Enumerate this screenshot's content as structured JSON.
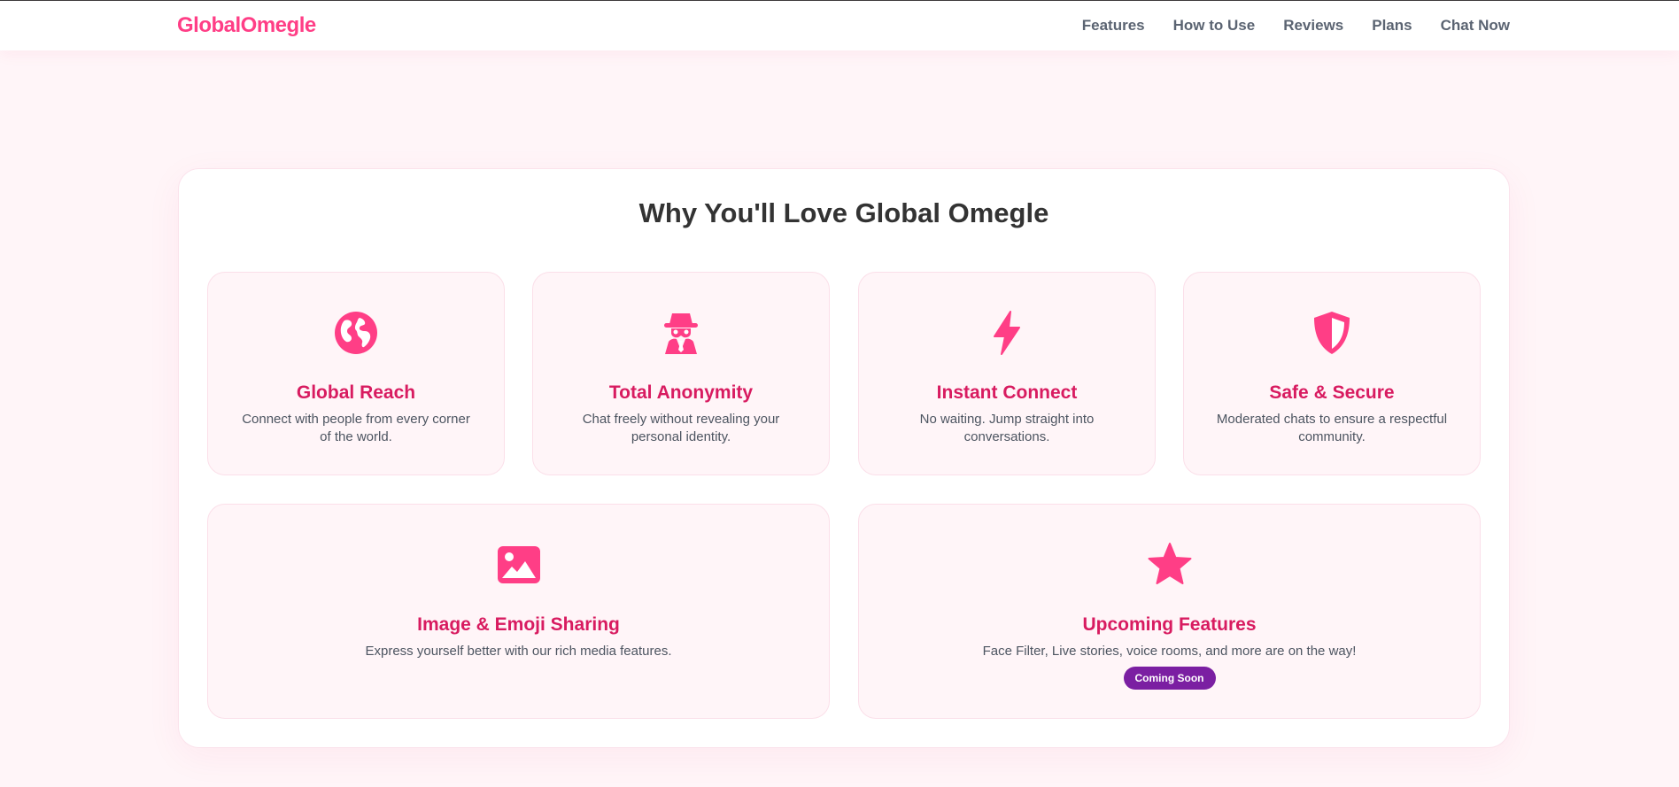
{
  "brand": {
    "name": "GlobalOmegle",
    "color": "#ff3e86"
  },
  "nav": {
    "links": [
      "Features",
      "How to Use",
      "Reviews",
      "Plans",
      "Chat Now"
    ]
  },
  "features_section": {
    "title": "Why You'll Love Global Omegle",
    "cards": [
      {
        "icon": "globe-icon",
        "title": "Global Reach",
        "description": "Connect with people from every corner of the world."
      },
      {
        "icon": "incognito-spy-icon",
        "title": "Total Anonymity",
        "description": "Chat freely without revealing your personal identity."
      },
      {
        "icon": "lightning-bolt-icon",
        "title": "Instant Connect",
        "description": "No waiting. Jump straight into conversations."
      },
      {
        "icon": "shield-icon",
        "title": "Safe & Secure",
        "description": "Moderated chats to ensure a respectful community."
      },
      {
        "icon": "image-icon",
        "title": "Image & Emoji Sharing",
        "description": "Express yourself better with our rich media features."
      },
      {
        "icon": "star-icon",
        "title": "Upcoming Features",
        "description": "Face Filter, Live stories, voice rooms, and more are on the way!",
        "badge": "Coming Soon"
      }
    ]
  },
  "colors": {
    "accent": "#ff3e86",
    "card_title": "#d81b60",
    "badge": "#7b1fa2",
    "page_background": "#fff5f8"
  }
}
